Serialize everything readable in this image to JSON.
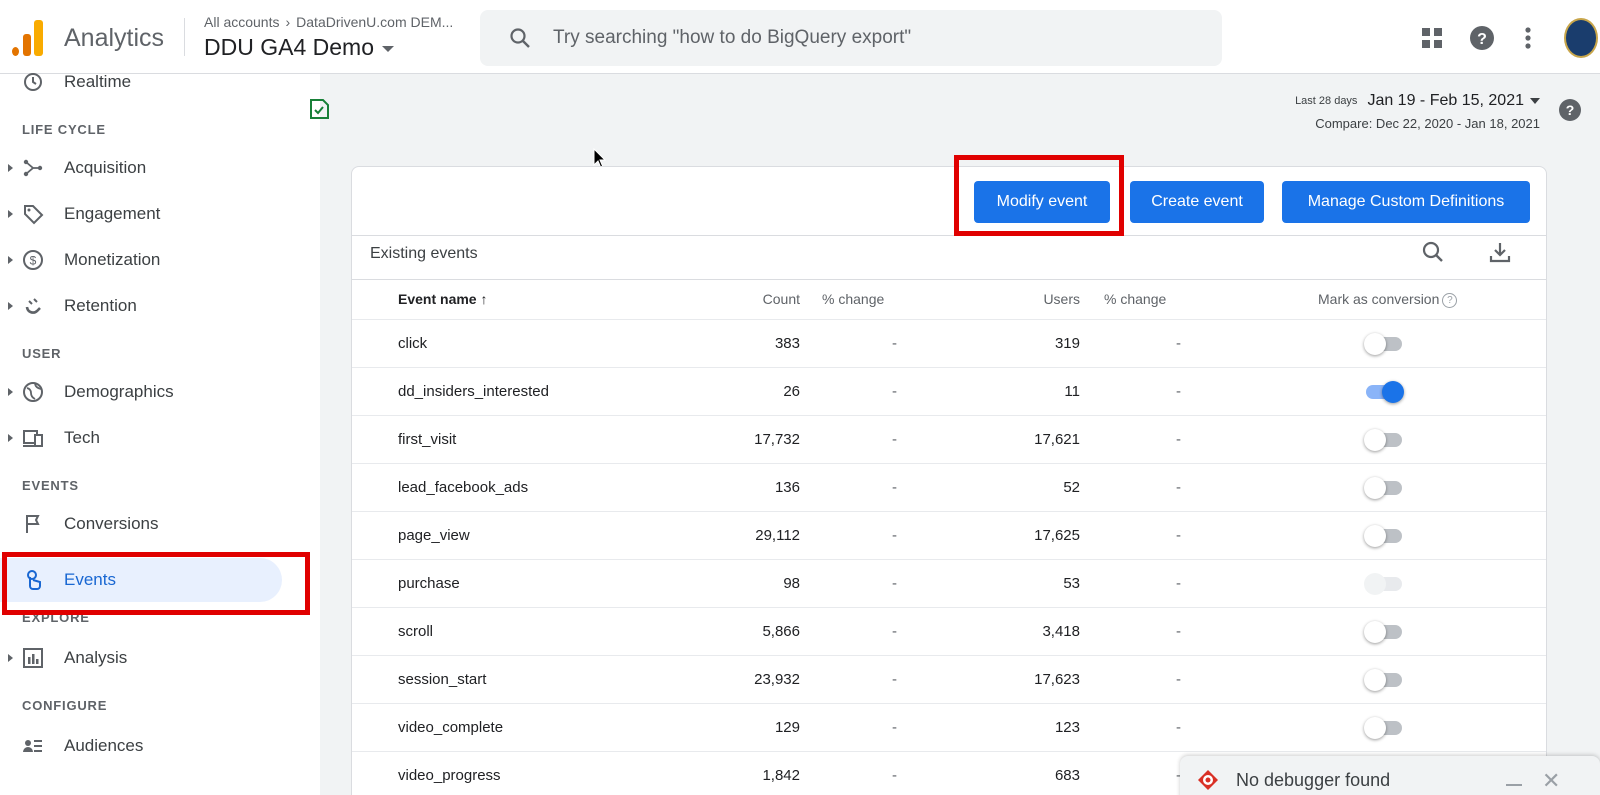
{
  "topbar": {
    "app_name": "Analytics",
    "breadcrumb_all": "All accounts",
    "breadcrumb_account": "DataDrivenU.com DEM...",
    "property_name": "DDU GA4 Demo",
    "search_placeholder": "Try searching \"how to do BigQuery export\"",
    "icons": [
      "apps-icon",
      "help-icon",
      "more-vert-icon",
      "avatar"
    ]
  },
  "sidebar": {
    "partial_item": "Realtime",
    "sections": {
      "lifecycle": "LIFE CYCLE",
      "user": "USER",
      "events": "EVENTS",
      "explore": "EXPLORE",
      "configure": "CONFIGURE"
    },
    "items": {
      "acquisition": "Acquisition",
      "engagement": "Engagement",
      "monetization": "Monetization",
      "retention": "Retention",
      "demographics": "Demographics",
      "tech": "Tech",
      "conversions": "Conversions",
      "events": "Events",
      "analysis": "Analysis",
      "audiences": "Audiences"
    },
    "active_item": "Events"
  },
  "date": {
    "chip": "Last 28 days",
    "range": "Jan 19 - Feb 15, 2021",
    "compare": "Compare: Dec 22, 2020 - Jan 18, 2021"
  },
  "card": {
    "buttons": {
      "modify": "Modify event",
      "create": "Create event",
      "manage": "Manage Custom Definitions"
    },
    "title": "Existing events",
    "headers": {
      "name": "Event name",
      "sort_arrow": "↑",
      "count": "Count",
      "pct_change_1": "% change",
      "users": "Users",
      "pct_change_2": "% change",
      "conversion": "Mark as conversion",
      "conversion_help": "?"
    },
    "rows": [
      {
        "name": "click",
        "count": "383",
        "pch1": "-",
        "users": "319",
        "pch2": "-",
        "conversion": "off"
      },
      {
        "name": "dd_insiders_interested",
        "count": "26",
        "pch1": "-",
        "users": "11",
        "pch2": "-",
        "conversion": "on"
      },
      {
        "name": "first_visit",
        "count": "17,732",
        "pch1": "-",
        "users": "17,621",
        "pch2": "-",
        "conversion": "off"
      },
      {
        "name": "lead_facebook_ads",
        "count": "136",
        "pch1": "-",
        "users": "52",
        "pch2": "-",
        "conversion": "off"
      },
      {
        "name": "page_view",
        "count": "29,112",
        "pch1": "-",
        "users": "17,625",
        "pch2": "-",
        "conversion": "off"
      },
      {
        "name": "purchase",
        "count": "98",
        "pch1": "-",
        "users": "53",
        "pch2": "-",
        "conversion": "disabled"
      },
      {
        "name": "scroll",
        "count": "5,866",
        "pch1": "-",
        "users": "3,418",
        "pch2": "-",
        "conversion": "off"
      },
      {
        "name": "session_start",
        "count": "23,932",
        "pch1": "-",
        "users": "17,623",
        "pch2": "-",
        "conversion": "off"
      },
      {
        "name": "video_complete",
        "count": "129",
        "pch1": "-",
        "users": "123",
        "pch2": "-",
        "conversion": "off"
      },
      {
        "name": "video_progress",
        "count": "1,842",
        "pch1": "-",
        "users": "683",
        "pch2": "-",
        "conversion": "off"
      }
    ]
  },
  "toast": {
    "label": "No debugger found",
    "close": "✕"
  },
  "colors": {
    "accent": "#1a73e8",
    "highlight_box": "#e00000",
    "logo_orange": "#f9ab00"
  }
}
